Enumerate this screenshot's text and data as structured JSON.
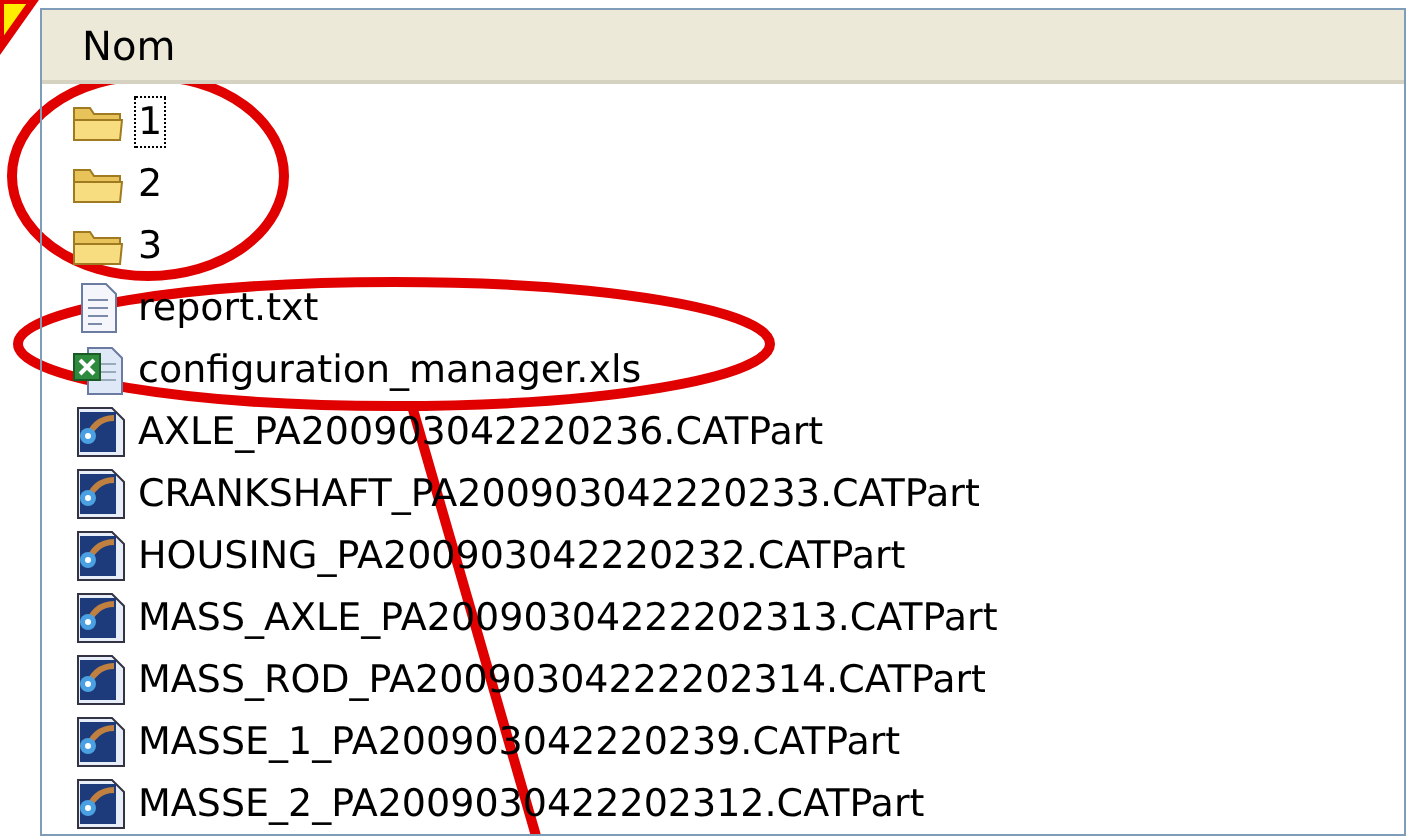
{
  "list_header": {
    "label": "Nom"
  },
  "files": [
    {
      "name": "1",
      "kind": "folder",
      "selected": true
    },
    {
      "name": "2",
      "kind": "folder",
      "selected": false
    },
    {
      "name": "3",
      "kind": "folder",
      "selected": false
    },
    {
      "name": "report.txt",
      "kind": "text",
      "selected": false
    },
    {
      "name": "configuration_manager.xls",
      "kind": "spreadsheet",
      "selected": false
    },
    {
      "name": "AXLE_PA200903042220236.CATPart",
      "kind": "part",
      "selected": false
    },
    {
      "name": "CRANKSHAFT_PA200903042220233.CATPart",
      "kind": "part",
      "selected": false
    },
    {
      "name": "HOUSING_PA200903042220232.CATPart",
      "kind": "part",
      "selected": false
    },
    {
      "name": "MASS_AXLE_PA20090304222202313.CATPart",
      "kind": "part",
      "selected": false
    },
    {
      "name": "MASS_ROD_PA20090304222202314.CATPart",
      "kind": "part",
      "selected": false
    },
    {
      "name": "MASSE_1_PA200903042220239.CATPart",
      "kind": "part",
      "selected": false
    },
    {
      "name": "MASSE_2_PA2009030422202312.CATPart",
      "kind": "part",
      "selected": false
    }
  ]
}
